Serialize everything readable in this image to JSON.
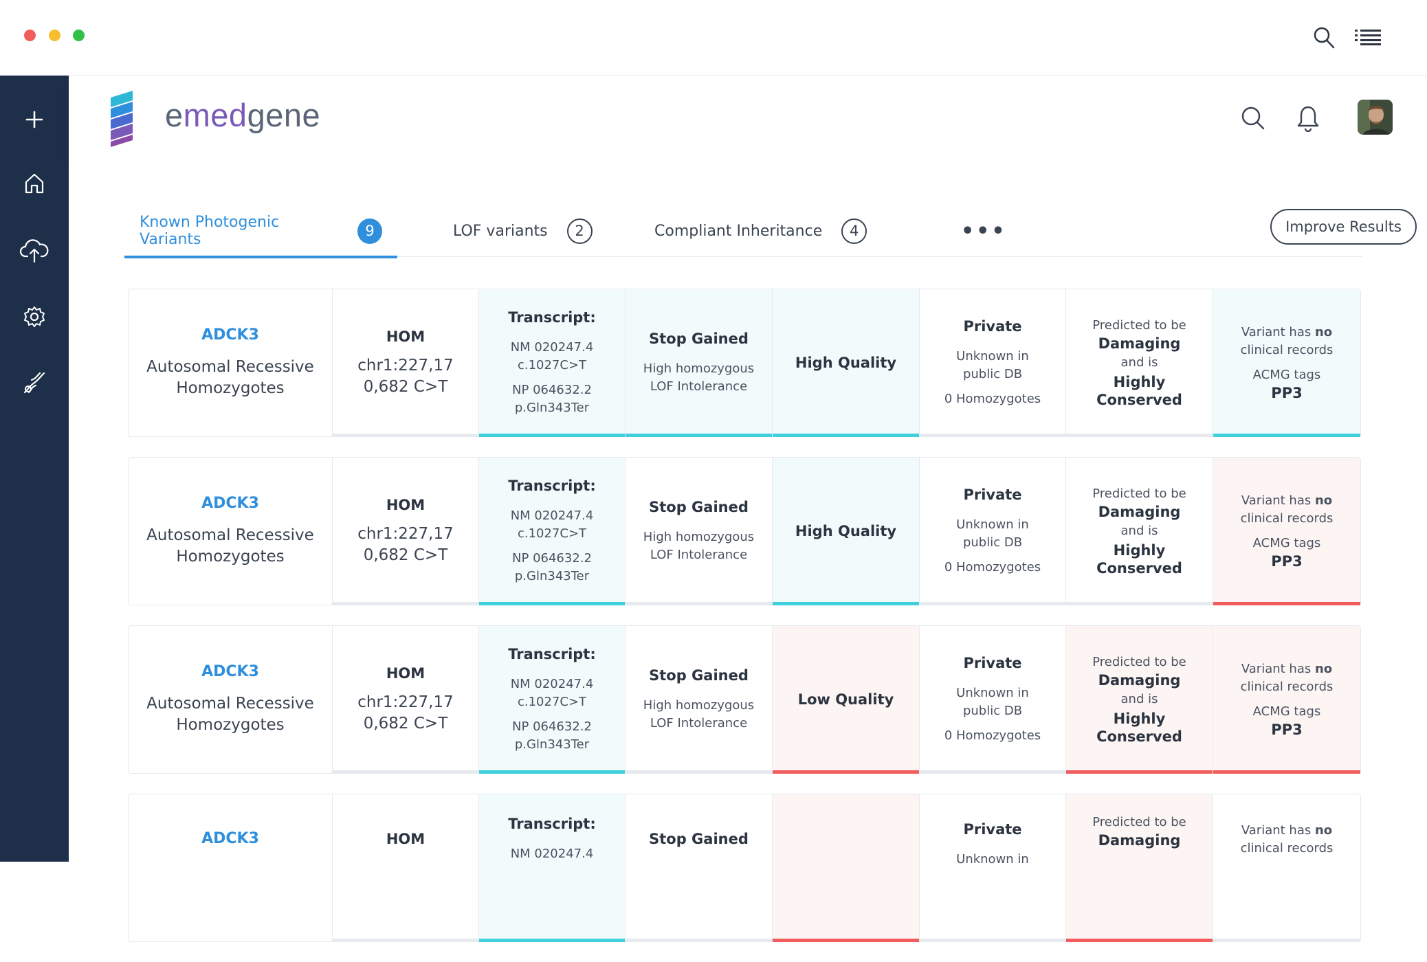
{
  "window": {
    "controls": [
      {
        "name": "close",
        "color": "#f25c5c"
      },
      {
        "name": "minimize",
        "color": "#f7be2f"
      },
      {
        "name": "maximize",
        "color": "#32c046"
      }
    ],
    "toolbar_icons": [
      "search-icon",
      "list-icon"
    ]
  },
  "sidebar": {
    "items": [
      {
        "icon": "plus-icon"
      },
      {
        "icon": "home-icon"
      },
      {
        "icon": "cloud-upload-icon"
      },
      {
        "icon": "gear-icon"
      },
      {
        "icon": "dna-icon"
      }
    ],
    "bg_color": "#1e2f49"
  },
  "app": {
    "logo_prefix": "e",
    "logo_middle": "med",
    "logo_suffix": "gene",
    "header_icons": [
      "search-icon",
      "bell-icon",
      "avatar"
    ]
  },
  "tabs": [
    {
      "label": "Known Photogenic Variants",
      "count": "9",
      "active": true
    },
    {
      "label": "LOF variants",
      "count": "2",
      "active": false
    },
    {
      "label": "Compliant Inheritance",
      "count": "4",
      "active": false
    }
  ],
  "more_label": "•••",
  "improve_button": "Improve Results",
  "colors": {
    "accent": "#2f8fdc",
    "good": "#3fcfdd",
    "bad": "#f25c5c"
  },
  "rows": [
    {
      "gene": "ADCK3",
      "inheritance_1": "Autosomal Recessive",
      "inheritance_2": "Homozygotes",
      "zygosity": "HOM",
      "position_1": "chr1:227,17",
      "position_2": "0,682 C>T",
      "transcript_label": "Transcript:",
      "nm_1": "NM 020247.4",
      "nm_2": "c.1027C>T",
      "np_1": "NP 064632.2",
      "np_2": "p.Gln343Ter",
      "effect": "Stop Gained",
      "effect_1": "High homozygous",
      "effect_2": "LOF Intolerance",
      "quality": "High Quality",
      "freq": "Private",
      "freq_1": "Unknown in",
      "freq_2": "public DB",
      "freq_3": "0 Homozygotes",
      "pred_1": "Predicted to be",
      "pred_2": "Damaging",
      "pred_3": "and is",
      "pred_4": "Highly",
      "pred_5": "Conserved",
      "clin_1a": "Variant has ",
      "clin_1b": "no",
      "clin_2": "clinical records",
      "clin_3": "ACMG tags",
      "clin_4": "PP3"
    },
    {
      "gene": "ADCK3",
      "inheritance_1": "Autosomal Recessive",
      "inheritance_2": "Homozygotes",
      "zygosity": "HOM",
      "position_1": "chr1:227,17",
      "position_2": "0,682 C>T",
      "transcript_label": "Transcript:",
      "nm_1": "NM 020247.4",
      "nm_2": "c.1027C>T",
      "np_1": "NP 064632.2",
      "np_2": "p.Gln343Ter",
      "effect": "Stop Gained",
      "effect_1": "High homozygous",
      "effect_2": "LOF Intolerance",
      "quality": "High Quality",
      "freq": "Private",
      "freq_1": "Unknown in",
      "freq_2": "public DB",
      "freq_3": "0 Homozygotes",
      "pred_1": "Predicted to be",
      "pred_2": "Damaging",
      "pred_3": "and is",
      "pred_4": "Highly",
      "pred_5": "Conserved",
      "clin_1a": "Variant has ",
      "clin_1b": "no",
      "clin_2": "clinical records",
      "clin_3": "ACMG tags",
      "clin_4": "PP3"
    },
    {
      "gene": "ADCK3",
      "inheritance_1": "Autosomal Recessive",
      "inheritance_2": "Homozygotes",
      "zygosity": "HOM",
      "position_1": "chr1:227,17",
      "position_2": "0,682 C>T",
      "transcript_label": "Transcript:",
      "nm_1": "NM 020247.4",
      "nm_2": "c.1027C>T",
      "np_1": "NP 064632.2",
      "np_2": "p.Gln343Ter",
      "effect": "Stop Gained",
      "effect_1": "High homozygous",
      "effect_2": "LOF Intolerance",
      "quality": "Low Quality",
      "freq": "Private",
      "freq_1": "Unknown in",
      "freq_2": "public DB",
      "freq_3": "0 Homozygotes",
      "pred_1": "Predicted to be",
      "pred_2": "Damaging",
      "pred_3": "and is",
      "pred_4": "Highly",
      "pred_5": "Conserved",
      "clin_1a": "Variant has ",
      "clin_1b": "no",
      "clin_2": "clinical records",
      "clin_3": "ACMG tags",
      "clin_4": "PP3"
    },
    {
      "gene": "ADCK3",
      "zygosity": "HOM",
      "transcript_label": "Transcript:",
      "nm_1": "NM 020247.4",
      "effect": "Stop Gained",
      "freq": "Private",
      "freq_1": "Unknown in",
      "pred_1": "Predicted to be",
      "pred_2": "Damaging",
      "clin_1a": "Variant has ",
      "clin_1b": "no",
      "clin_2": "clinical records"
    }
  ]
}
